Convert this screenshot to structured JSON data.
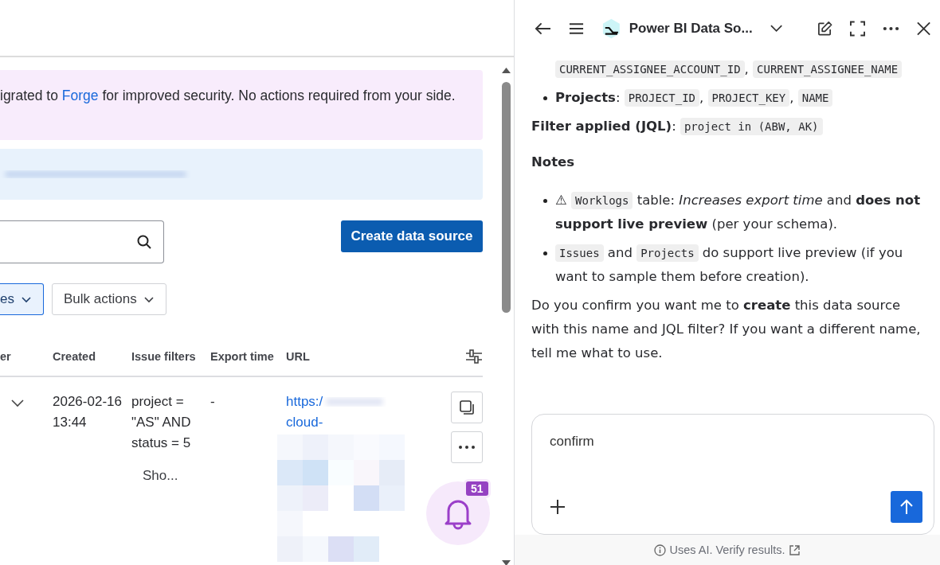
{
  "main": {
    "banner": {
      "before": "igrated to ",
      "link": "Forge",
      "after": " for improved security. No actions required from your side."
    },
    "create_button": "Create data source",
    "filter_chip": {
      "label": "es",
      "selected": true
    },
    "bulk_button": "Bulk actions",
    "table": {
      "columns": [
        "er",
        "Created",
        "Issue filters",
        "Export time",
        "URL"
      ],
      "rows": [
        {
          "expanded": false,
          "created": "2026-02-16 13:44",
          "filters": "project = \"AS\" AND status = 5",
          "export_time": "-",
          "url_start": "https:/",
          "url_end": "cloud-",
          "show_more": "Sho..."
        }
      ]
    },
    "notifications": {
      "count": "51"
    }
  },
  "assistant": {
    "title": "Power BI Data So...",
    "blocks": [
      {
        "kind": "continuation",
        "segments": [
          {
            "kind": "code",
            "text": "CURRENT_ASSIGNEE_ACCOUNT_ID"
          },
          {
            "kind": "text",
            "text": ", "
          },
          {
            "kind": "code",
            "text": "CURRENT_ASSIGNEE_NAME"
          }
        ]
      },
      {
        "kind": "bullet",
        "segments": [
          {
            "kind": "text",
            "text": "**Projects**: "
          },
          {
            "kind": "code",
            "text": "PROJECT_ID"
          },
          {
            "kind": "text",
            "text": ", "
          },
          {
            "kind": "code",
            "text": "PROJECT_KEY"
          },
          {
            "kind": "text",
            "text": ", "
          },
          {
            "kind": "code",
            "text": "NAME"
          }
        ]
      },
      {
        "kind": "para",
        "segments": [
          {
            "kind": "text",
            "text": "**Filter applied (JQL)**: "
          },
          {
            "kind": "code",
            "text": "project in (ABW, AK)"
          }
        ]
      },
      {
        "kind": "heading",
        "segments": [
          {
            "kind": "text",
            "text": "Notes"
          }
        ]
      },
      {
        "kind": "bullet",
        "segments": [
          {
            "kind": "text",
            "text": "⚠ "
          },
          {
            "kind": "code",
            "text": "Worklogs"
          },
          {
            "kind": "text",
            "text": " table: *Increases export time* and **does not support live preview** (per your schema)."
          }
        ]
      },
      {
        "kind": "bullet",
        "segments": [
          {
            "kind": "code",
            "text": "Issues"
          },
          {
            "kind": "text",
            "text": " and "
          },
          {
            "kind": "code",
            "text": "Projects"
          },
          {
            "kind": "text",
            "text": " do support live preview (if you want to sample them before creation)."
          }
        ]
      },
      {
        "kind": "para",
        "segments": [
          {
            "kind": "text",
            "text": "Do you confirm you want me to **create** this data source with this name and JQL filter? If you want a different name, tell me what to use."
          }
        ]
      }
    ],
    "composer": {
      "value": "confirm"
    },
    "footer": "Uses AI. Verify results."
  }
}
